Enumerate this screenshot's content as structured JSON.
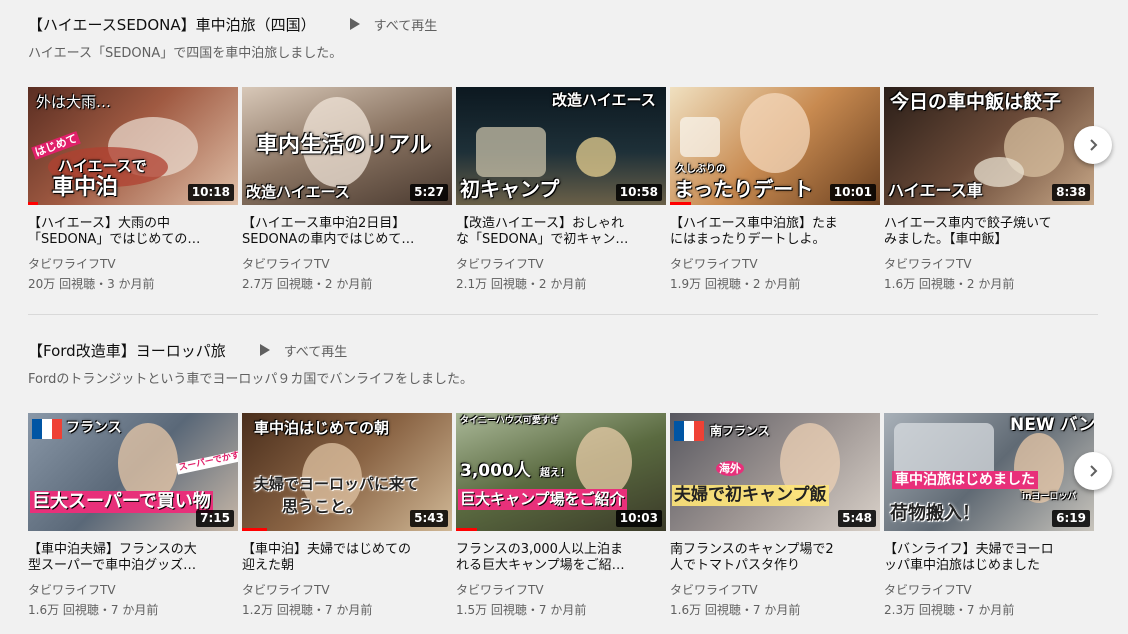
{
  "shelves": [
    {
      "title": "【ハイエースSEDONA】車中泊旅（四国）",
      "play_all": "すべて再生",
      "description": "ハイエース「SEDONA」で四国を車中泊旅しました。",
      "videos": [
        {
          "title_line1": "【ハイエース】大雨の中",
          "title_line2": "「SEDONA」ではじめての…",
          "channel": "タビワライフTV",
          "meta": "20万 回視聴・3 か月前",
          "duration": "10:18",
          "watched": 0.05,
          "thumb_texts": [
            "外は大雨…",
            "はじめて",
            "ハイエースで",
            "車中泊"
          ],
          "palette": [
            "#6b3a2a",
            "#c98a6a",
            "#e8d6c8"
          ]
        },
        {
          "title_line1": "【ハイエース車中泊2日目】",
          "title_line2": "SEDONAの車内ではじめて…",
          "channel": "タビワライフTV",
          "meta": "2.7万 回視聴・2 か月前",
          "duration": "5:27",
          "watched": 0,
          "thumb_texts": [
            "車内生活のリアル",
            "改造ハイエース"
          ],
          "palette": [
            "#5a4a3e",
            "#a8907a",
            "#d8c8b8"
          ]
        },
        {
          "title_line1": "【改造ハイエース】おしゃれ",
          "title_line2": "な「SEDONA」で初キャン…",
          "channel": "タビワライフTV",
          "meta": "2.1万 回視聴・2 か月前",
          "duration": "10:58",
          "watched": 0,
          "thumb_texts": [
            "改造ハイエース",
            "初キャンプ"
          ],
          "palette": [
            "#13202a",
            "#2e4a52",
            "#c8b890"
          ]
        },
        {
          "title_line1": "【ハイエース車中泊旅】たま",
          "title_line2": "にはまったりデートしよ。",
          "channel": "タビワライフTV",
          "meta": "1.9万 回視聴・2 か月前",
          "duration": "10:01",
          "watched": 0.1,
          "thumb_texts": [
            "久しぶりの",
            "まったりデート"
          ],
          "palette": [
            "#8a5a32",
            "#d4a06a",
            "#f0e2c8"
          ]
        },
        {
          "title_line1": "ハイエース車内で餃子焼いて",
          "title_line2": "みました。【車中飯】",
          "channel": "タビワライフTV",
          "meta": "1.6万 回視聴・2 か月前",
          "duration": "8:38",
          "watched": 0,
          "thumb_texts": [
            "今日の車中飯は餃子",
            "ハイエース車"
          ],
          "palette": [
            "#3a2a22",
            "#8a6248",
            "#d8b896"
          ]
        }
      ]
    },
    {
      "title": "【Ford改造車】ヨーロッパ旅",
      "play_all": "すべて再生",
      "description": "Fordのトランジットという車でヨーロッパ９カ国でバンライフをしました。",
      "videos": [
        {
          "title_line1": "【車中泊夫婦】フランスの大",
          "title_line2": "型スーパーで車中泊グッズ…",
          "channel": "タビワライフTV",
          "meta": "1.6万 回視聴・7 か月前",
          "duration": "7:15",
          "watched": 0,
          "thumb_texts": [
            "フランス",
            "スーパーでかすぎ！",
            "巨大スーパーで買い物"
          ],
          "palette": [
            "#4a5a6a",
            "#9aa8b0",
            "#e8ddd0"
          ]
        },
        {
          "title_line1": "【車中泊】夫婦ではじめての",
          "title_line2": "迎えた朝",
          "channel": "タビワライフTV",
          "meta": "1.2万 回視聴・7 か月前",
          "duration": "5:43",
          "watched": 0.12,
          "thumb_texts": [
            "車中泊はじめての朝",
            "夫婦でヨーロッパに来て",
            "思うこと。"
          ],
          "palette": [
            "#5a3a22",
            "#9a7050",
            "#d8c0a0"
          ]
        },
        {
          "title_line1": "フランスの3,000人以上泊ま",
          "title_line2": "れる巨大キャンプ場をご紹…",
          "channel": "タビワライフTV",
          "meta": "1.5万 回視聴・7 か月前",
          "duration": "10:03",
          "watched": 0.1,
          "thumb_texts": [
            "タイニーハウス可愛すぎ",
            "3,000人",
            "超え！",
            "巨大キャンプ場をご紹介"
          ],
          "palette": [
            "#3e4a2a",
            "#7a8a5a",
            "#c8c8a8"
          ]
        },
        {
          "title_line1": "南フランスのキャンプ場で2",
          "title_line2": "人でトマトパスタ作り",
          "channel": "タビワライフTV",
          "meta": "1.6万 回視聴・7 か月前",
          "duration": "5:48",
          "watched": 0,
          "thumb_texts": [
            "南フランス",
            "海外",
            "夫婦で初キャンプ飯"
          ],
          "palette": [
            "#6a6a72",
            "#b0a8a0",
            "#e0d8d0"
          ]
        },
        {
          "title_line1": "【バンライフ】夫婦でヨーロ",
          "title_line2": "ッパ車中泊旅はじめました",
          "channel": "タビワライフTV",
          "meta": "2.3万 回視聴・7 か月前",
          "duration": "6:19",
          "watched": 0,
          "thumb_texts": [
            "NEW バン",
            "車中泊旅はじめました",
            "inヨーロッパ",
            "荷物搬入！"
          ],
          "palette": [
            "#5a6470",
            "#98a4b0",
            "#d8dce0"
          ]
        }
      ]
    }
  ]
}
